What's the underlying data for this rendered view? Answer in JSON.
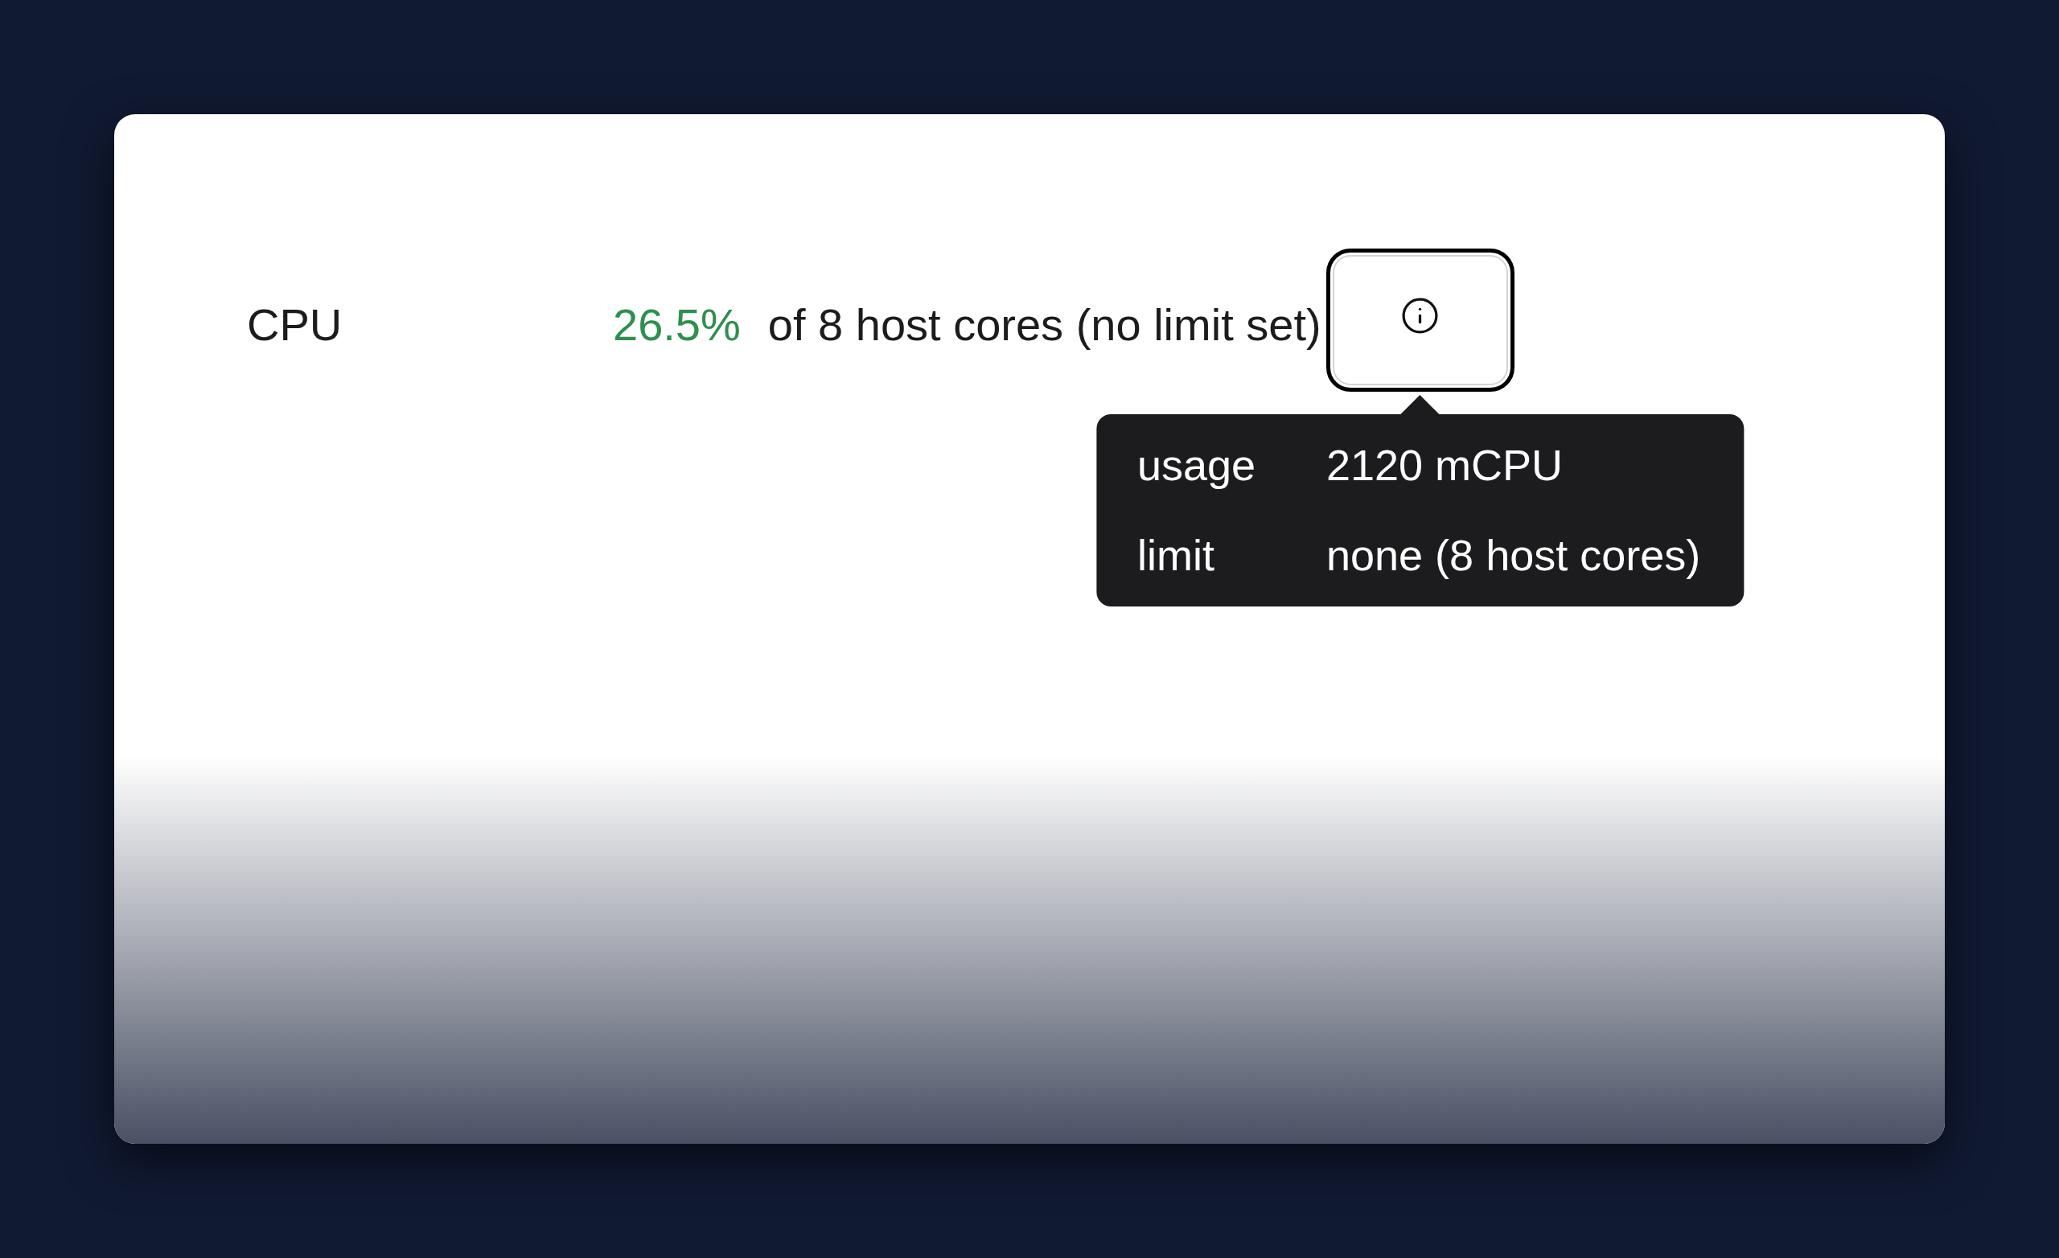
{
  "metric": {
    "label": "CPU",
    "value": "26.5%",
    "detail": "of 8 host cores (no limit set)"
  },
  "info_button": {
    "focused": true
  },
  "tooltip": {
    "rows": [
      {
        "label": "usage",
        "value": "2120 mCPU"
      },
      {
        "label": "limit",
        "value": "none (8 host cores)"
      }
    ]
  }
}
